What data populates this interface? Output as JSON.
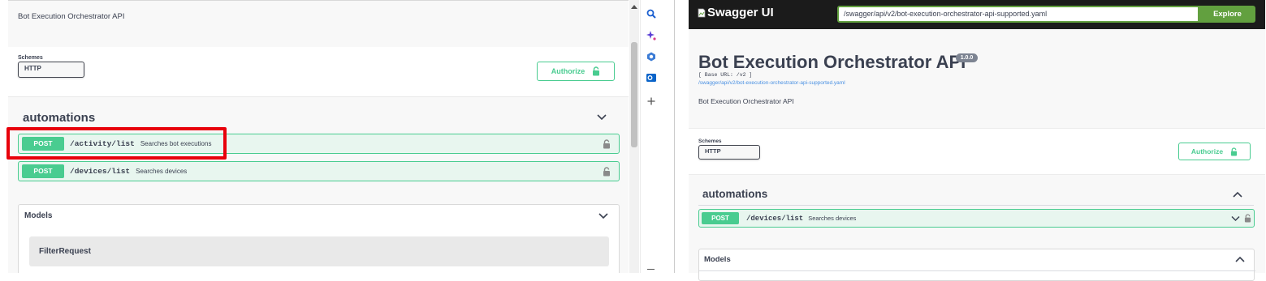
{
  "left": {
    "description": "Bot Execution Orchestrator API",
    "schemes_label": "Schemes",
    "scheme_selected": "HTTP",
    "authorize_label": "Authorize",
    "tag_name": "automations",
    "operations": [
      {
        "method": "POST",
        "path": "/activity/list",
        "summary": "Searches bot executions"
      },
      {
        "method": "POST",
        "path": "/devices/list",
        "summary": "Searches devices"
      }
    ],
    "models_title": "Models",
    "models": [
      "FilterRequest"
    ]
  },
  "right": {
    "logo": "Swagger UI",
    "url_value": "/swagger/api/v2/bot-execution-orchestrator-api-supported.yaml",
    "explore_label": "Explore",
    "title": "Bot Execution Orchestrator API",
    "version": "1.0.0",
    "base_url": "[ Base URL: /v2 ]",
    "spec_link": "/swagger/api/v2/bot-execution-orchestrator-api-supported.yaml",
    "description": "Bot Execution Orchestrator API",
    "schemes_label": "Schemes",
    "scheme_selected": "HTTP",
    "authorize_label": "Authorize",
    "tag_name": "automations",
    "operations": [
      {
        "method": "POST",
        "path": "/devices/list",
        "summary": "Searches devices"
      }
    ],
    "models_title": "Models"
  },
  "colors": {
    "post_green": "#49cc90",
    "highlight_red": "#e8000b",
    "explore_green": "#62a03f",
    "topbar": "#1b1b1b"
  },
  "icons": [
    "search-icon",
    "sparkle-icon",
    "copilot-icon",
    "outlook-icon",
    "plus-icon",
    "lock-icon",
    "chevron-down-icon",
    "chevron-up-icon"
  ]
}
